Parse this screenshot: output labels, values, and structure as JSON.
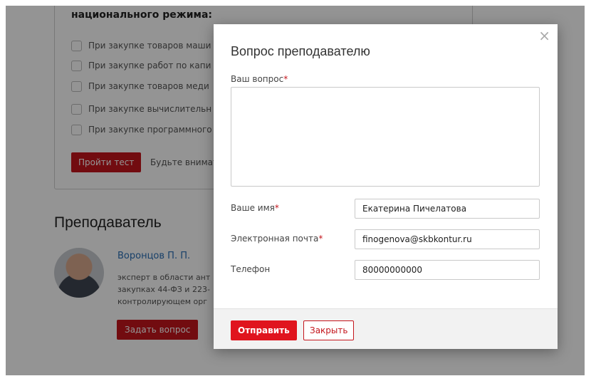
{
  "background": {
    "quiz": {
      "heading": "национального режима:",
      "options": [
        "При закупке товаров маши",
        "При закупке работ по капи",
        "При закупке товаров меди",
        "При закупке вычислительн",
        "При закупке программного"
      ],
      "submit_label": "Пройти тест",
      "note": "Будьте внимат"
    },
    "teacher": {
      "heading": "Преподаватель",
      "name": "Воронцов П. П.",
      "description": "эксперт в области ант закупках 44-ФЗ и 223- контролирующем орг",
      "ask_label": "Задать вопрос"
    }
  },
  "modal": {
    "title": "Вопрос преподавателю",
    "close_icon": "×",
    "question_label": "Ваш вопрос",
    "question_value": "",
    "name_label": "Ваше имя",
    "name_value": "Екатерина Пичелатова",
    "email_label": "Электронная почта",
    "email_value": "finogenova@skbkontur.ru",
    "phone_label": "Телефон",
    "phone_value": "80000000000",
    "required_mark": "*",
    "send_label": "Отправить",
    "close_label": "Закрыть"
  },
  "colors": {
    "accent": "#e0141e",
    "link": "#2a6fb6"
  }
}
